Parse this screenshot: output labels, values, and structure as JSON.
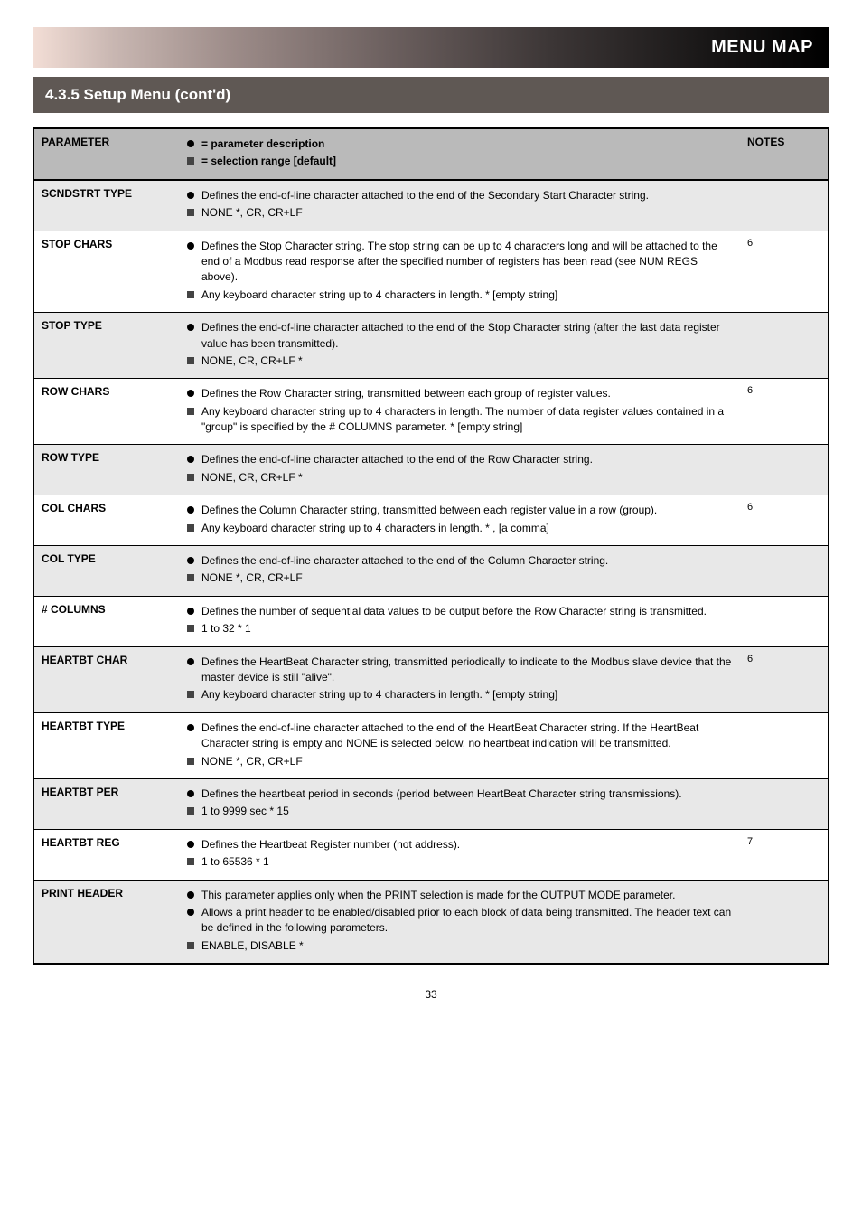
{
  "header": {
    "label": "MENU MAP"
  },
  "section": {
    "title": "4.3.5 Setup Menu (cont'd)"
  },
  "table": {
    "head": {
      "param_col": "PARAMETER",
      "desc_legend": "= parameter description",
      "range_legend": "= selection range [default]",
      "notes_col": "NOTES"
    },
    "rows": [
      {
        "param": "SCNDSTRT TYPE",
        "items": [
          {
            "type": "desc",
            "text": "Defines the end-of-line character attached to the end of the Secondary Start Character string."
          },
          {
            "type": "range",
            "text": "NONE *, CR, CR+LF"
          }
        ],
        "notes": ""
      },
      {
        "param": "STOP CHARS",
        "items": [
          {
            "type": "desc",
            "text": "Defines the Stop Character string. The stop string can be up to 4 characters long and will be attached to the end of a Modbus read response after the specified number of registers has been read (see NUM REGS above)."
          },
          {
            "type": "range",
            "text": "Any keyboard character string up to 4 characters in length. * [empty string]"
          }
        ],
        "notes": "6"
      },
      {
        "param": "STOP TYPE",
        "items": [
          {
            "type": "desc",
            "text": "Defines the end-of-line character attached to the end of the Stop Character string (after the last data register value has been transmitted)."
          },
          {
            "type": "range",
            "text": "NONE, CR, CR+LF *"
          }
        ],
        "notes": ""
      },
      {
        "param": "ROW CHARS",
        "items": [
          {
            "type": "desc",
            "text": "Defines the Row Character string, transmitted between each group of register values."
          },
          {
            "type": "range",
            "text": "Any keyboard character string up to 4 characters in length. The number of data register values contained in a \"group\" is specified by the # COLUMNS parameter. * [empty string]"
          }
        ],
        "notes": "6"
      },
      {
        "param": "ROW TYPE",
        "items": [
          {
            "type": "desc",
            "text": "Defines the end-of-line character attached to the end of the Row Character string."
          },
          {
            "type": "range",
            "text": "NONE, CR, CR+LF *"
          }
        ],
        "notes": ""
      },
      {
        "param": "COL CHARS",
        "items": [
          {
            "type": "desc",
            "text": "Defines the Column Character string, transmitted between each register value in a row (group)."
          },
          {
            "type": "range",
            "text": "Any keyboard character string up to 4 characters in length. * , [a comma]"
          }
        ],
        "notes": "6"
      },
      {
        "param": "COL TYPE",
        "items": [
          {
            "type": "desc",
            "text": "Defines the end-of-line character attached to the end of the Column Character string."
          },
          {
            "type": "range",
            "text": "NONE *, CR, CR+LF"
          }
        ],
        "notes": ""
      },
      {
        "param": "# COLUMNS",
        "items": [
          {
            "type": "desc",
            "text": "Defines the number of sequential data values to be output before the Row Character string is transmitted."
          },
          {
            "type": "range",
            "text": "1 to 32  * 1"
          }
        ],
        "notes": ""
      },
      {
        "param": "HEARTBT CHAR",
        "items": [
          {
            "type": "desc",
            "text": "Defines the HeartBeat Character string, transmitted periodically to indicate to the Modbus slave device that the master device is still \"alive\"."
          },
          {
            "type": "range",
            "text": "Any keyboard character string up to 4 characters in length. * [empty string]"
          }
        ],
        "notes": "6"
      },
      {
        "param": "HEARTBT TYPE",
        "items": [
          {
            "type": "desc",
            "text": "Defines the end-of-line character attached to the end of the HeartBeat Character string. If the HeartBeat Character string is empty and NONE is selected below, no heartbeat indication will be transmitted."
          },
          {
            "type": "range",
            "text": "NONE *, CR, CR+LF"
          }
        ],
        "notes": ""
      },
      {
        "param": "HEARTBT PER",
        "items": [
          {
            "type": "desc",
            "text": "Defines the heartbeat period in seconds (period between HeartBeat Character string transmissions)."
          },
          {
            "type": "range",
            "text": "1 to 9999 sec  * 15"
          }
        ],
        "notes": ""
      },
      {
        "param": "HEARTBT REG",
        "items": [
          {
            "type": "desc",
            "text": "Defines the Heartbeat Register number (not address)."
          },
          {
            "type": "range",
            "text": "1 to 65536  * 1"
          }
        ],
        "notes": "7"
      },
      {
        "param": "PRINT HEADER",
        "items": [
          {
            "type": "desc",
            "text": "This parameter applies only when the PRINT selection is made for the OUTPUT MODE parameter."
          },
          {
            "type": "desc",
            "text": "Allows a print header to be enabled/disabled prior to each block of data being transmitted. The header text can be defined in the following parameters."
          },
          {
            "type": "range",
            "text": "ENABLE, DISABLE *"
          }
        ],
        "notes": ""
      }
    ]
  },
  "page_number": "33"
}
